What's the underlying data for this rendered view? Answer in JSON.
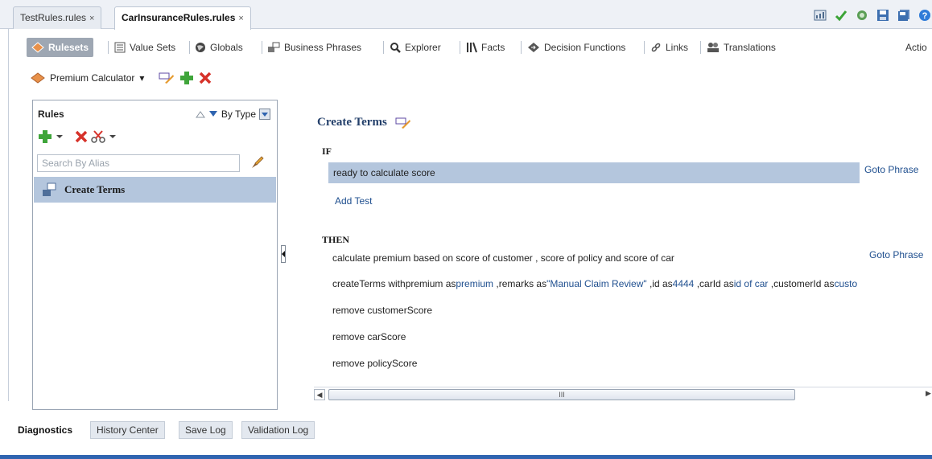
{
  "editor_tabs": [
    {
      "label": "TestRules.rules",
      "close": "×"
    },
    {
      "label": "CarInsuranceRules.rules",
      "close": "×"
    }
  ],
  "nav_tabs": [
    {
      "label": "Rulesets",
      "icon": "ruleset-icon"
    },
    {
      "label": "Value Sets",
      "icon": "value-sets-icon"
    },
    {
      "label": "Globals",
      "icon": "globe-icon"
    },
    {
      "label": "Business Phrases",
      "icon": "business-phrases-icon"
    },
    {
      "label": "Explorer",
      "icon": "search-icon"
    },
    {
      "label": "Facts",
      "icon": "facts-icon"
    },
    {
      "label": "Decision Functions",
      "icon": "decision-function-icon"
    },
    {
      "label": "Links",
      "icon": "link-icon"
    },
    {
      "label": "Translations",
      "icon": "translations-icon"
    }
  ],
  "actions_label": "Actio",
  "ruleset": {
    "name": "Premium Calculator",
    "dropdown": "▾"
  },
  "rules_panel": {
    "title": "Rules",
    "sort_label": "By Type",
    "search_placeholder": "Search By Alias",
    "items": [
      {
        "label": "Create Terms"
      }
    ]
  },
  "rule": {
    "title": "Create Terms",
    "if_label": "IF",
    "then_label": "THEN",
    "condition": "ready to calculate score",
    "goto_phrase": "Goto Phrase",
    "add_test": "Add Test",
    "actions": {
      "a1": "calculate premium based on score of customer , score of policy and score of car",
      "a2_p1": "createTerms withpremium as",
      "a2_v1": "premium",
      "a2_p2": " ,remarks as",
      "a2_v2": "\"Manual Claim Review\"",
      "a2_p3": " ,id as",
      "a2_v3": "4444",
      "a2_p4": " ,carId as",
      "a2_v4": "id of car",
      "a2_p5": " ,customerId as",
      "a2_v5": "custo",
      "a3": "remove customerScore",
      "a4": "remove carScore",
      "a5": "remove policyScore"
    }
  },
  "scrollbar": {
    "grip": "III"
  },
  "bottom_tabs": [
    {
      "label": "Diagnostics"
    },
    {
      "label": "History Center"
    },
    {
      "label": "Save Log"
    },
    {
      "label": "Validation Log"
    }
  ],
  "colors": {
    "accent": "#2f64b0",
    "selection": "#b4c6dd",
    "link": "#1f4f8f"
  }
}
